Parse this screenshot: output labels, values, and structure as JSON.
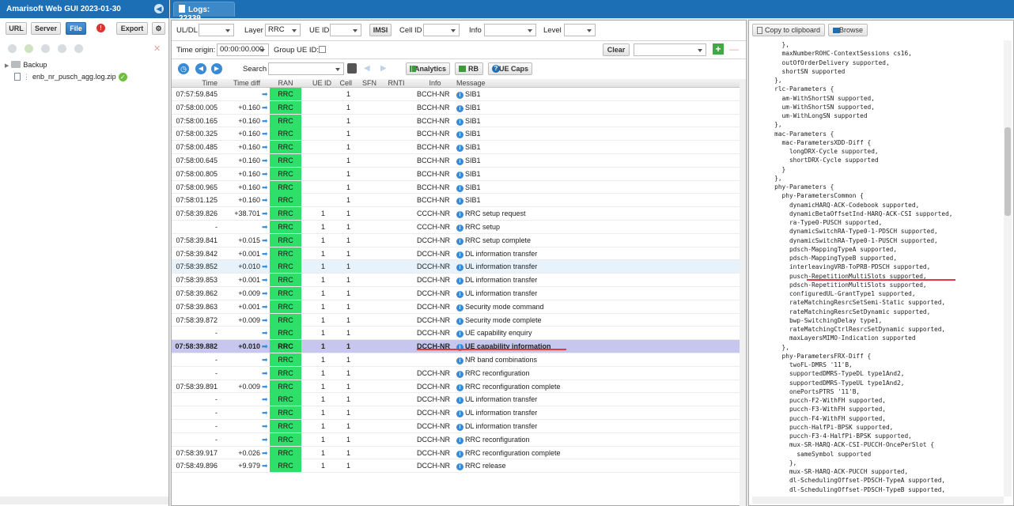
{
  "app": {
    "title": "Amarisoft Web GUI 2023-01-30"
  },
  "left_toolbar": {
    "url": "URL",
    "server": "Server",
    "file": "File",
    "export": "Export"
  },
  "tree": {
    "folder": "Backup",
    "file": "enb_nr_pusch_agg.log.zip"
  },
  "tab": {
    "label": "Logs: 22339"
  },
  "filters": {
    "uldl_label": "UL/DL",
    "uldl_value": "",
    "layer_label": "Layer",
    "layer_value": "RRC",
    "ueid_label": "UE ID",
    "ueid_value": "",
    "imsi_label": "IMSI",
    "cellid_label": "Cell ID",
    "cellid_value": "",
    "info_label": "Info",
    "info_value": "",
    "level_label": "Level",
    "level_value": "",
    "time_origin_label": "Time origin:",
    "time_origin_value": "00:00:00.000",
    "group_ue_label": "Group UE ID:",
    "clear": "Clear"
  },
  "toolbar": {
    "search_label": "Search",
    "analytics": "Analytics",
    "rb": "RB",
    "ue_caps": "UE Caps"
  },
  "columns": [
    "Time",
    "Time diff",
    "RAN",
    "UE ID",
    "Cell",
    "SFN",
    "RNTI",
    "Info",
    "Message"
  ],
  "rows": [
    {
      "time": "07:57:59.845",
      "diff": "",
      "ran": "RRC",
      "ue": "",
      "cell": "1",
      "info": "BCCH-NR",
      "msg": "SIB1"
    },
    {
      "time": "07:58:00.005",
      "diff": "+0.160",
      "ran": "RRC",
      "ue": "",
      "cell": "1",
      "info": "BCCH-NR",
      "msg": "SIB1"
    },
    {
      "time": "07:58:00.165",
      "diff": "+0.160",
      "ran": "RRC",
      "ue": "",
      "cell": "1",
      "info": "BCCH-NR",
      "msg": "SIB1"
    },
    {
      "time": "07:58:00.325",
      "diff": "+0.160",
      "ran": "RRC",
      "ue": "",
      "cell": "1",
      "info": "BCCH-NR",
      "msg": "SIB1"
    },
    {
      "time": "07:58:00.485",
      "diff": "+0.160",
      "ran": "RRC",
      "ue": "",
      "cell": "1",
      "info": "BCCH-NR",
      "msg": "SIB1"
    },
    {
      "time": "07:58:00.645",
      "diff": "+0.160",
      "ran": "RRC",
      "ue": "",
      "cell": "1",
      "info": "BCCH-NR",
      "msg": "SIB1"
    },
    {
      "time": "07:58:00.805",
      "diff": "+0.160",
      "ran": "RRC",
      "ue": "",
      "cell": "1",
      "info": "BCCH-NR",
      "msg": "SIB1"
    },
    {
      "time": "07:58:00.965",
      "diff": "+0.160",
      "ran": "RRC",
      "ue": "",
      "cell": "1",
      "info": "BCCH-NR",
      "msg": "SIB1"
    },
    {
      "time": "07:58:01.125",
      "diff": "+0.160",
      "ran": "RRC",
      "ue": "",
      "cell": "1",
      "info": "BCCH-NR",
      "msg": "SIB1"
    },
    {
      "time": "07:58:39.826",
      "diff": "+38.701",
      "ran": "RRC",
      "ue": "1",
      "cell": "1",
      "info": "CCCH-NR",
      "msg": "RRC setup request"
    },
    {
      "time": "-",
      "diff": "",
      "ran": "RRC",
      "ue": "1",
      "cell": "1",
      "info": "CCCH-NR",
      "msg": "RRC setup"
    },
    {
      "time": "07:58:39.841",
      "diff": "+0.015",
      "ran": "RRC",
      "ue": "1",
      "cell": "1",
      "info": "DCCH-NR",
      "msg": "RRC setup complete"
    },
    {
      "time": "07:58:39.842",
      "diff": "+0.001",
      "ran": "RRC",
      "ue": "1",
      "cell": "1",
      "info": "DCCH-NR",
      "msg": "DL information transfer"
    },
    {
      "time": "07:58:39.852",
      "diff": "+0.010",
      "ran": "RRC",
      "ue": "1",
      "cell": "1",
      "info": "DCCH-NR",
      "msg": "UL information transfer"
    },
    {
      "time": "07:58:39.853",
      "diff": "+0.001",
      "ran": "RRC",
      "ue": "1",
      "cell": "1",
      "info": "DCCH-NR",
      "msg": "DL information transfer"
    },
    {
      "time": "07:58:39.862",
      "diff": "+0.009",
      "ran": "RRC",
      "ue": "1",
      "cell": "1",
      "info": "DCCH-NR",
      "msg": "UL information transfer"
    },
    {
      "time": "07:58:39.863",
      "diff": "+0.001",
      "ran": "RRC",
      "ue": "1",
      "cell": "1",
      "info": "DCCH-NR",
      "msg": "Security mode command"
    },
    {
      "time": "07:58:39.872",
      "diff": "+0.009",
      "ran": "RRC",
      "ue": "1",
      "cell": "1",
      "info": "DCCH-NR",
      "msg": "Security mode complete"
    },
    {
      "time": "-",
      "diff": "",
      "ran": "RRC",
      "ue": "1",
      "cell": "1",
      "info": "DCCH-NR",
      "msg": "UE capability enquiry"
    },
    {
      "time": "07:58:39.882",
      "diff": "+0.010",
      "ran": "RRC",
      "ue": "1",
      "cell": "1",
      "info": "DCCH-NR",
      "msg": "UE capability information"
    },
    {
      "time": "-",
      "diff": "",
      "ran": "RRC",
      "ue": "1",
      "cell": "1",
      "info": "",
      "msg": "NR band combinations"
    },
    {
      "time": "-",
      "diff": "",
      "ran": "RRC",
      "ue": "1",
      "cell": "1",
      "info": "DCCH-NR",
      "msg": "RRC reconfiguration"
    },
    {
      "time": "07:58:39.891",
      "diff": "+0.009",
      "ran": "RRC",
      "ue": "1",
      "cell": "1",
      "info": "DCCH-NR",
      "msg": "RRC reconfiguration complete"
    },
    {
      "time": "-",
      "diff": "",
      "ran": "RRC",
      "ue": "1",
      "cell": "1",
      "info": "DCCH-NR",
      "msg": "UL information transfer"
    },
    {
      "time": "-",
      "diff": "",
      "ran": "RRC",
      "ue": "1",
      "cell": "1",
      "info": "DCCH-NR",
      "msg": "UL information transfer"
    },
    {
      "time": "-",
      "diff": "",
      "ran": "RRC",
      "ue": "1",
      "cell": "1",
      "info": "DCCH-NR",
      "msg": "DL information transfer"
    },
    {
      "time": "-",
      "diff": "",
      "ran": "RRC",
      "ue": "1",
      "cell": "1",
      "info": "DCCH-NR",
      "msg": "RRC reconfiguration"
    },
    {
      "time": "07:58:39.917",
      "diff": "+0.026",
      "ran": "RRC",
      "ue": "1",
      "cell": "1",
      "info": "DCCH-NR",
      "msg": "RRC reconfiguration complete"
    },
    {
      "time": "07:58:49.896",
      "diff": "+9.979",
      "ran": "RRC",
      "ue": "1",
      "cell": "1",
      "info": "DCCH-NR",
      "msg": "RRC release"
    }
  ],
  "right_toolbar": {
    "copy": "Copy to clipboard",
    "browse": "Browse"
  },
  "code_lines": [
    "        },",
    "        maxNumberROHC-ContextSessions cs16,",
    "        outOfOrderDelivery supported,",
    "        shortSN supported",
    "      },",
    "      rlc-Parameters {",
    "        am-WithShortSN supported,",
    "        um-WithShortSN supported,",
    "        um-WithLongSN supported",
    "      },",
    "      mac-Parameters {",
    "        mac-ParametersXDD-Diff {",
    "          longDRX-Cycle supported,",
    "          shortDRX-Cycle supported",
    "        }",
    "      },",
    "      phy-Parameters {",
    "        phy-ParametersCommon {",
    "          dynamicHARQ-ACK-Codebook supported,",
    "          dynamicBetaOffsetInd-HARQ-ACK-CSI supported,",
    "          ra-Type0-PUSCH supported,",
    "          dynamicSwitchRA-Type0-1-PDSCH supported,",
    "          dynamicSwitchRA-Type0-1-PUSCH supported,",
    "          pdsch-MappingTypeA supported,",
    "          pdsch-MappingTypeB supported,",
    "          interleavingVRB-ToPRB-PDSCH supported,",
    "          pusch-RepetitionMultiSlots supported,",
    "          pdsch-RepetitionMultiSlots supported,",
    "          configuredUL-GrantType1 supported,",
    "          rateMatchingResrcSetSemi-Static supported,",
    "          rateMatchingResrcSetDynamic supported,",
    "          bwp-SwitchingDelay type1,",
    "          rateMatchingCtrlResrcSetDynamic supported,",
    "          maxLayersMIMO-Indication supported",
    "        },",
    "        phy-ParametersFRX-Diff {",
    "          twoFL-DMRS '11'B,",
    "          supportedDMRS-TypeDL type1And2,",
    "          supportedDMRS-TypeUL type1And2,",
    "          onePortsPTRS '11'B,",
    "          pucch-F2-WithFH supported,",
    "          pucch-F3-WithFH supported,",
    "          pucch-F4-WithFH supported,",
    "          pucch-HalfPi-BPSK supported,",
    "          pucch-F3-4-HalfPi-BPSK supported,",
    "          mux-SR-HARQ-ACK-CSI-PUCCH-OncePerSlot {",
    "            sameSymbol supported",
    "          },",
    "          mux-SR-HARQ-ACK-PUCCH supported,",
    "          dl-SchedulingOffset-PDSCH-TypeA supported,",
    "          dl-SchedulingOffset-PDSCH-TypeB supported,"
  ],
  "colors": {
    "brand_blue": "#1c6fb4",
    "ran_green": "#2ee06a",
    "selected_row": "#c6c6ee",
    "underline_red": "#e23b3b"
  }
}
